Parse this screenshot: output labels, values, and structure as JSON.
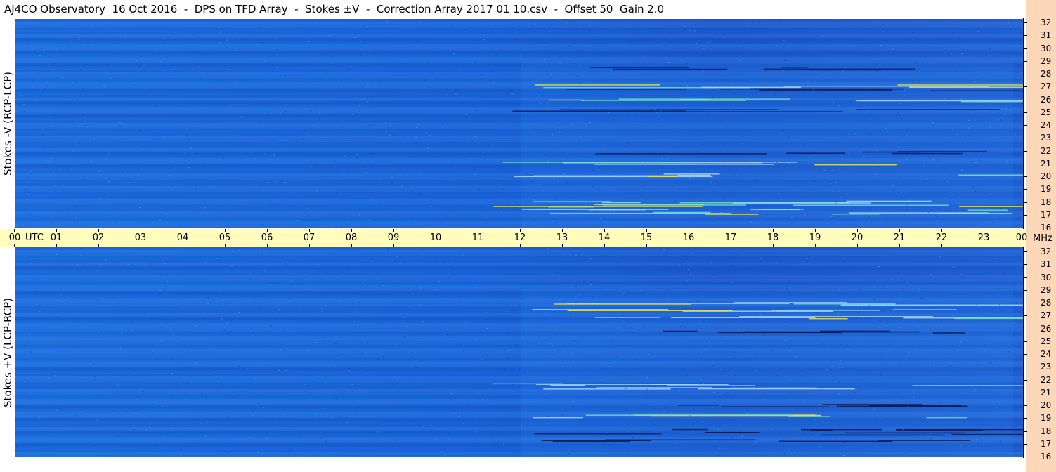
{
  "title": "AJ4CO Observatory  16 Oct 2016  -  DPS on TFD Array  -  Stokes ±V  -  Correction Array 2017 01 10.csv  -  Offset 50  Gain 2.0",
  "panels": {
    "top_ylabel": "Stokes -V (RCP-LCP)",
    "bottom_ylabel": "Stokes +V (LCP-RCP)"
  },
  "time_axis": {
    "utc_label": "UTC",
    "unit_label": "MHz",
    "hours": [
      "00",
      "01",
      "02",
      "03",
      "04",
      "05",
      "06",
      "07",
      "08",
      "09",
      "10",
      "11",
      "12",
      "13",
      "14",
      "15",
      "16",
      "17",
      "18",
      "19",
      "20",
      "21",
      "22",
      "23",
      "00"
    ]
  },
  "freq_axis": {
    "labels": [
      "32",
      "31",
      "30",
      "29",
      "28",
      "27",
      "26",
      "25",
      "24",
      "23",
      "22",
      "21",
      "20",
      "19",
      "18",
      "17",
      "16"
    ]
  },
  "colors": {
    "background_blue": "#1a64dc",
    "time_bar": "#fffcbc",
    "side_strip": "#fcd7b9"
  }
}
